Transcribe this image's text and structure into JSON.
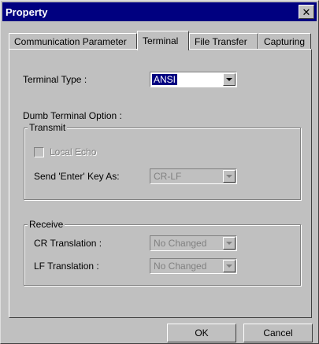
{
  "window": {
    "title": "Property",
    "close_glyph": "✕"
  },
  "tabs": [
    {
      "label": "Communication Parameter"
    },
    {
      "label": "Terminal"
    },
    {
      "label": "File Transfer"
    },
    {
      "label": "Capturing"
    }
  ],
  "terminal_type": {
    "label": "Terminal Type :",
    "value": "ANSI"
  },
  "dumb_option": {
    "label": "Dumb Terminal Option :"
  },
  "transmit": {
    "legend": "Transmit",
    "local_echo_label": "Local Echo",
    "send_enter_label": "Send 'Enter' Key As:",
    "send_enter_value": "CR-LF"
  },
  "receive": {
    "legend": "Receive",
    "cr_label": "CR Translation :",
    "cr_value": "No Changed",
    "lf_label": "LF Translation :",
    "lf_value": "No Changed"
  },
  "buttons": {
    "ok": "OK",
    "cancel": "Cancel"
  }
}
